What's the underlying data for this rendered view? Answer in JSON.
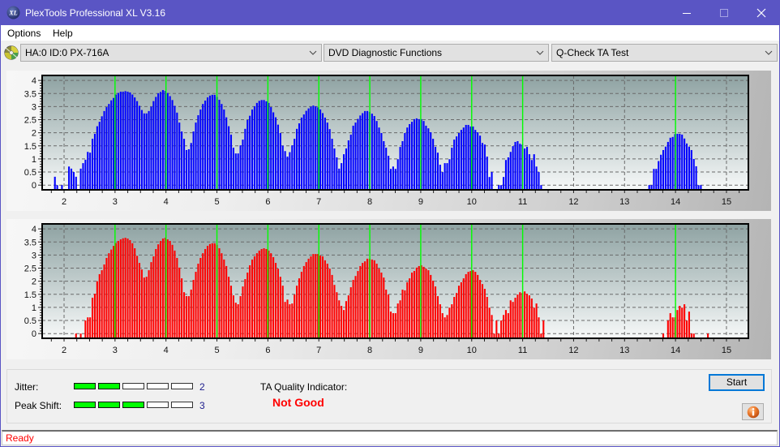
{
  "window": {
    "title": "PlexTools Professional XL V3.16",
    "title_bar_color": "#5A55C4",
    "icons": {
      "app": "xl-logo-icon",
      "minimize": "minimize-icon",
      "maximize": "maximize-icon",
      "close": "close-icon"
    }
  },
  "menu": {
    "items": [
      {
        "label": "Options"
      },
      {
        "label": "Help"
      }
    ]
  },
  "toolbar": {
    "drive_icon": "optical-disc-icon",
    "drive_select": {
      "value": "HA:0 ID:0  PX-716A"
    },
    "function_select": {
      "value": "DVD Diagnostic Functions"
    },
    "test_select": {
      "value": "Q-Check TA Test"
    }
  },
  "chart_data": [
    {
      "type": "bar",
      "title": "",
      "xlabel": "",
      "ylabel": "",
      "xlim": [
        1.57,
        15.43
      ],
      "ylim": [
        -0.18,
        4.19
      ],
      "grid": true,
      "xticks": [
        2,
        3,
        4,
        5,
        6,
        7,
        8,
        9,
        10,
        11,
        12,
        13,
        14,
        15
      ],
      "xtick_labels": [
        "2",
        "3",
        "4",
        "5",
        "6",
        "7",
        "8",
        "9",
        "10",
        "11",
        "12",
        "13",
        "14",
        "15"
      ],
      "yticks": [
        0,
        0.5,
        1,
        1.5,
        2,
        2.5,
        3,
        3.5,
        4
      ],
      "ytick_labels": [
        "0",
        "0.5",
        "1",
        "1.5",
        "2",
        "2.5",
        "3",
        "3.5",
        "4"
      ],
      "markers": [
        3,
        4,
        5,
        6,
        7,
        8,
        9,
        10,
        11,
        14
      ],
      "marker_color": "#00FF00",
      "series": [
        {
          "name": "",
          "color": "#0000FF",
          "x0": 1.82,
          "step": 0.0461,
          "segments": [
            {
              "start_bin": 0,
              "values": [
                0.32,
                0,
                null,
                0,
                null,
                null,
                0.71,
                0.63,
                0.5,
                0.32,
                null,
                0.63,
                0.84,
                0.97,
                1.27,
                1.24,
                1.77,
                1.96,
                2.25,
                2.42,
                2.63,
                2.83,
                2.98,
                3.1,
                3.24,
                3.33,
                3.46,
                3.52,
                3.57,
                3.57,
                3.59,
                3.57,
                3.54,
                3.46,
                3.35,
                3.21,
                3.03,
                2.87,
                2.74,
                2.74,
                2.83,
                3.0,
                3.21,
                3.37,
                3.51,
                3.56,
                3.63,
                3.6,
                3.52,
                3.4,
                3.25,
                3.03,
                2.77,
                2.39,
                2.05,
                1.77,
                1.34,
                1.37,
                1.61,
                2.05,
                2.39,
                2.67,
                2.89,
                3.1,
                3.23,
                3.35,
                3.42,
                3.45,
                3.45,
                3.37,
                3.26,
                3.1,
                2.89,
                2.59,
                2.25,
                1.93,
                1.43,
                1.21,
                1.21,
                1.52,
                1.74,
                2.15,
                2.49,
                2.65,
                2.89,
                3.01,
                3.14,
                3.22,
                3.25,
                3.25,
                3.2,
                3.14,
                2.98,
                2.78,
                2.59,
                2.31,
                1.99,
                1.51,
                1.3,
                1.09,
                1.26,
                1.52,
                1.77,
                2.15,
                2.36,
                2.58,
                2.7,
                2.84,
                2.93,
                3.0,
                3.04,
                3.01,
                2.97,
                2.89,
                2.75,
                2.58,
                2.39,
                2.14,
                1.77,
                1.4,
                1.06,
                0.63,
                0.84,
                1.18,
                1.4,
                1.71,
                1.93,
                2.27,
                2.39,
                2.53,
                2.66,
                2.75,
                2.83,
                2.83,
                2.8,
                2.73,
                2.64,
                2.45,
                2.2,
                1.99,
                1.68,
                1.43,
                1.12,
                0.62,
                0.71,
                0.62,
                0.99,
                1.46,
                1.68,
                1.99,
                2.2,
                2.33,
                2.42,
                2.52,
                2.55,
                2.52,
                2.52,
                2.45,
                2.27,
                2.17,
                2.02,
                1.77,
                1.46,
                1.24,
                0.78,
                0.5,
                0.84,
                0.84,
                0.99,
                1.43,
                1.74,
                1.86,
                1.99,
                2.11,
                2.2,
                2.3,
                2.3,
                2.24,
                2.24,
                2.11,
                2.02,
                1.89,
                1.61,
                1.55,
                1.09,
                0.31,
                0.5,
                null,
                null,
                0,
                0,
                0.31,
                0.96,
                1.06,
                1.27,
                1.49,
                1.65,
                1.68,
                1.58,
                1.55,
                1.4,
                1.46,
                1.18,
                0.96,
                1.18,
                0.71,
                0.5,
                0
              ]
            },
            {
              "start_bin": 253,
              "values": [
                0,
                0,
                0.62,
                0.62,
                0.92,
                1.16,
                1.34,
                1.47,
                1.65,
                1.81,
                1.84,
                1.95,
                1.96,
                1.96,
                1.93,
                1.78,
                1.59,
                1.47,
                1.34,
                1.0,
                0.72,
                0,
                0
              ]
            }
          ]
        }
      ]
    },
    {
      "type": "bar",
      "title": "",
      "xlabel": "",
      "ylabel": "",
      "xlim": [
        1.57,
        15.43
      ],
      "ylim": [
        -0.18,
        4.19
      ],
      "grid": true,
      "xticks": [
        2,
        3,
        4,
        5,
        6,
        7,
        8,
        9,
        10,
        11,
        12,
        13,
        14,
        15
      ],
      "xtick_labels": [
        "2",
        "3",
        "4",
        "5",
        "6",
        "7",
        "8",
        "9",
        "10",
        "11",
        "12",
        "13",
        "14",
        "15"
      ],
      "yticks": [
        0,
        0.5,
        1,
        1.5,
        2,
        2.5,
        3,
        3.5,
        4
      ],
      "ytick_labels": [
        "0",
        "0.5",
        "1",
        "1.5",
        "2",
        "2.5",
        "3",
        "3.5",
        "4"
      ],
      "markers": [
        3,
        4,
        5,
        6,
        7,
        8,
        9,
        10,
        11,
        14
      ],
      "marker_color": "#00FF00",
      "series": [
        {
          "name": "",
          "color": "#FF0000",
          "x0": 1.82,
          "step": 0.0461,
          "segments": [
            {
              "start_bin": 9,
              "values": [
                0,
                null,
                0,
                null,
                0.5,
                0.62,
                0.62,
                1.37,
                1.52,
                2.0,
                2.27,
                2.42,
                2.64,
                2.89,
                3.07,
                3.21,
                3.35,
                3.46,
                3.54,
                3.6,
                3.64,
                3.66,
                3.63,
                3.57,
                3.45,
                3.26,
                2.97,
                2.7,
                2.45,
                2.14,
                2.17,
                2.42,
                2.73,
                2.95,
                3.23,
                3.41,
                3.54,
                3.63,
                3.66,
                3.6,
                3.54,
                3.39,
                3.17,
                2.89,
                2.52,
                2.11,
                1.58,
                1.43,
                1.43,
                1.68,
                2.05,
                2.36,
                2.67,
                2.89,
                3.07,
                3.23,
                3.35,
                3.42,
                3.45,
                3.45,
                3.39,
                3.26,
                3.07,
                2.83,
                2.58,
                2.17,
                1.83,
                1.46,
                1.18,
                1.12,
                1.43,
                1.8,
                2.08,
                2.33,
                2.61,
                2.83,
                2.95,
                3.07,
                3.17,
                3.23,
                3.26,
                3.23,
                3.17,
                3.07,
                2.92,
                2.7,
                2.48,
                2.17,
                1.83,
                1.21,
                1.3,
                1.12,
                1.15,
                1.49,
                1.83,
                2.11,
                2.36,
                2.58,
                2.73,
                2.86,
                2.95,
                3.04,
                3.04,
                3.04,
                2.98,
                2.95,
                2.8,
                2.67,
                2.48,
                2.24,
                1.86,
                1.58,
                1.27,
                1.06,
                0.9,
                1.24,
                1.46,
                1.77,
                2.05,
                2.2,
                2.39,
                2.58,
                2.7,
                2.76,
                2.86,
                2.86,
                2.83,
                2.8,
                2.67,
                2.48,
                2.33,
                2.14,
                1.68,
                1.49,
                0.84,
                0.78,
                0.78,
                1.15,
                1.27,
                1.68,
                1.65,
                1.96,
                2.11,
                2.33,
                2.39,
                2.52,
                2.58,
                2.61,
                2.55,
                2.48,
                2.42,
                2.24,
                2.02,
                1.8,
                1.43,
                1.12,
                0.78,
                0.62,
                0.71,
                0.99,
                1.12,
                1.4,
                1.55,
                1.83,
                1.96,
                2.11,
                2.27,
                2.36,
                2.39,
                2.42,
                2.36,
                2.24,
                2.05,
                1.89,
                1.71,
                1.4,
                0.99,
                0.71,
                0,
                0.5,
                0,
                0.5,
                0.71,
                0.9,
                0.78,
                1.27,
                1.21,
                1.37,
                1.49,
                1.58,
                1.55,
                1.61,
                1.52,
                1.46,
                1.34,
                0.99,
                1.15,
                0.62,
                0,
                0.5
              ]
            },
            {
              "start_bin": 259,
              "values": [
                0,
                null,
                0.5,
                0.78,
                0.62,
                0.62,
                0.9,
                1.06,
                0.99,
                1.12,
                0.5,
                0.84,
                0,
                0
              ]
            },
            {
              "start_bin": 278,
              "values": [
                0
              ]
            }
          ]
        }
      ]
    }
  ],
  "indicators": {
    "jitter": {
      "label": "Jitter:",
      "value": "2",
      "level": 2,
      "max": 5
    },
    "peak_shift": {
      "label": "Peak Shift:",
      "value": "3",
      "level": 3,
      "max": 5
    },
    "ta_quality": {
      "label": "TA Quality Indicator:",
      "value": "Not Good",
      "color": "#FF0000"
    }
  },
  "buttons": {
    "start": "Start",
    "info": "info-icon"
  },
  "status": {
    "text": "Ready",
    "color": "#FF0000"
  },
  "colors": {
    "level_on": "#00FF00",
    "accent": "#0078D7"
  }
}
